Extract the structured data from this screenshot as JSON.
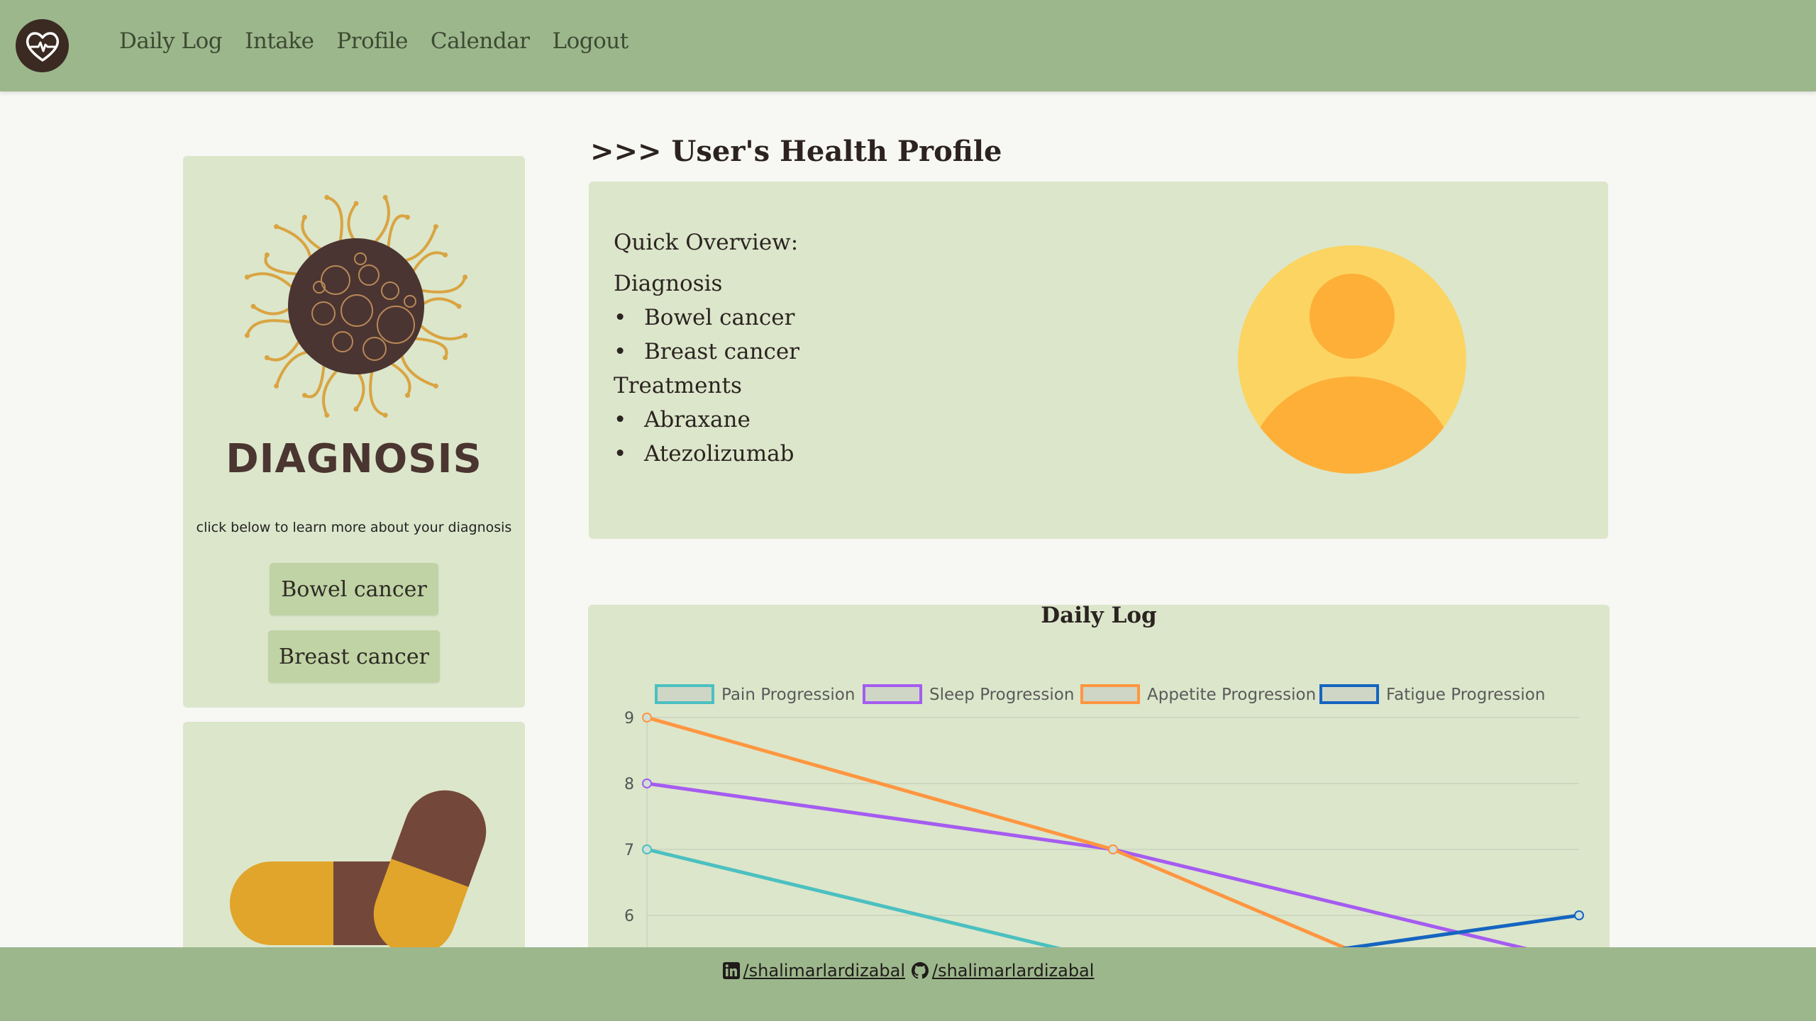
{
  "nav": {
    "logo_icon": "heart-pulse-icon",
    "links": [
      "Daily Log",
      "Intake",
      "Profile",
      "Calendar",
      "Logout"
    ]
  },
  "sidebar": {
    "diagnosis_card": {
      "image": "virus-illustration",
      "title": "DIAGNOSIS",
      "note": "click below to learn more about your diagnosis",
      "buttons": [
        "Bowel cancer",
        "Breast cancer"
      ]
    },
    "medication_card": {
      "image": "pill-capsules-illustration"
    }
  },
  "main": {
    "heading": ">>> User's Health Profile",
    "overview": {
      "title": "Quick Overview:",
      "diagnosis_label": "Diagnosis",
      "diagnoses": [
        "Bowel cancer",
        "Breast cancer"
      ],
      "treatments_label": "Treatments",
      "treatments": [
        "Abraxane",
        "Atezolizumab"
      ],
      "avatar": "user-avatar-icon"
    },
    "daily_log": {
      "title": "Daily Log"
    }
  },
  "chart_data": {
    "type": "line",
    "title": "Daily Log",
    "x": [
      0,
      1,
      2
    ],
    "y_ticks": [
      9,
      8,
      7,
      6
    ],
    "ylim": [
      5,
      9
    ],
    "grid": true,
    "legend_position": "top",
    "series": [
      {
        "name": "Pain Progression",
        "color": "#4bc0c0",
        "values": [
          7,
          5.3,
          4
        ]
      },
      {
        "name": "Sleep Progression",
        "color": "#a55cf0",
        "values": [
          8,
          7,
          5.3
        ]
      },
      {
        "name": "Appetite Progression",
        "color": "#ff9640",
        "values": [
          9,
          7,
          4
        ]
      },
      {
        "name": "Fatigue Progression",
        "color": "#1565c0",
        "values": [
          null,
          5,
          6
        ]
      }
    ]
  },
  "footer": {
    "links": [
      {
        "icon": "linkedin-icon",
        "text": "/shalimarlardizabal"
      },
      {
        "icon": "github-icon",
        "text": "/shalimarlardizabal"
      }
    ]
  }
}
